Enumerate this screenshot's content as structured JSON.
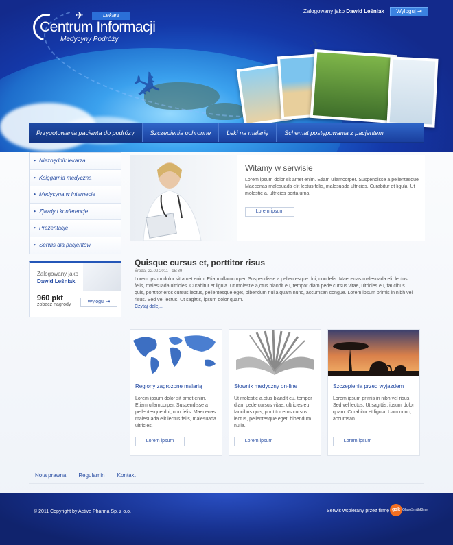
{
  "header": {
    "logo_badge": "Lekarz",
    "logo_title": "Centrum Informacji",
    "logo_subtitle": "Medycyny Podróży",
    "logged_in_prefix": "Zalogowany jako",
    "logged_in_user": "Dawid Leśniak",
    "logout_label": "Wyloguj"
  },
  "nav": {
    "items": [
      {
        "label": "Przygotowania pacjenta do podróży"
      },
      {
        "label": "Szczepienia ochronne"
      },
      {
        "label": "Leki na malarię"
      },
      {
        "label": "Schemat postępowania z pacjentem"
      }
    ]
  },
  "sidebar": {
    "items": [
      {
        "label": "Niezbędnik lekarza"
      },
      {
        "label": "Księgarnia medyczna"
      },
      {
        "label": "Medycyna w Internecie"
      },
      {
        "label": "Zjazdy i konferencje"
      },
      {
        "label": "Prezentacje"
      },
      {
        "label": "Serwis dla pacjentów"
      }
    ],
    "userbox": {
      "label": "Zalogowany jako",
      "name": "Dawid Leśniak",
      "points": "960 pkt",
      "rewards_link": "zobacz nagrody",
      "logout_label": "Wyloguj"
    }
  },
  "welcome": {
    "title": "Witamy w serwisie",
    "text": "Lorem ipsum dolor sit amet enim. Etiam ullamcorper. Suspendisse a pellentesque Maecenas malesuada elit lectus felis, malesuada ultricies. Curabitur et ligula. Ut molestie a, ultricies porta urna.",
    "button": "Lorem ipsum"
  },
  "article": {
    "title": "Quisque cursus et, porttitor risus",
    "date": "Środa, 22.02.2011 - 15:39",
    "text": "Lorem ipsum dolor sit amet enim. Etiam ullamcorper. Suspendisse a pellentesque dui, non felis. Maecenas malesuada elit lectus felis, malesuada ultricies. Curabitur et ligula. Ut molestie a,ctus blandit eu, tempor diam pede cursus vitae, ultricies eu, faucibus quis, porttitor eros cursus lectus, pellentesque eget, bibendum nulla quam nunc, accumsan congue. Lorem ipsum primis in nibh vel risus. Sed vel lectus. Ut sagittis, ipsum dolor quam.",
    "more": "Czytaj dalej..."
  },
  "cards": [
    {
      "title": "Regiony zagrożone malarią",
      "text": "Lorem ipsum dolor sit amet enim. Etiam ullamcorper. Suspendisse a pellentesque dui, non felis. Maecenas malesuada elit lectus felis, malesuada ultricies.",
      "button": "Lorem ipsum"
    },
    {
      "title": "Słownik medyczny on-line",
      "text": "Ut molestie a,ctus blandit eu, tempor diam pede cursus vitae, ultricies eu, faucibus quis, porttitor eros cursus lectus, pellentesque eget, bibendum nulla.",
      "button": "Lorem ipsum"
    },
    {
      "title": "Szczepienia przed wyjazdem",
      "text": "Lorem ipsum primis in nibh vel risus. Sed vel lectus. Ut sagittis, ipsum dolor quam. Curabitur et ligula. Uam nunc, accumsan.",
      "button": "Lorem ipsum"
    }
  ],
  "footer_links": [
    {
      "label": "Nota prawna"
    },
    {
      "label": "Regulamin"
    },
    {
      "label": "Kontakt"
    }
  ],
  "footer": {
    "copyright": "© 2011 Copyright by Active Pharma Sp. z o.o.",
    "sponsor_text": "Serwis wspierany przez firmę",
    "sponsor_logo_short": "gsk",
    "sponsor_logo_name": "GlaxoSmithKline"
  },
  "colors": {
    "brand_blue": "#1a3f9e",
    "link_blue": "#2a4fa3",
    "gsk_orange": "#f36f21"
  }
}
